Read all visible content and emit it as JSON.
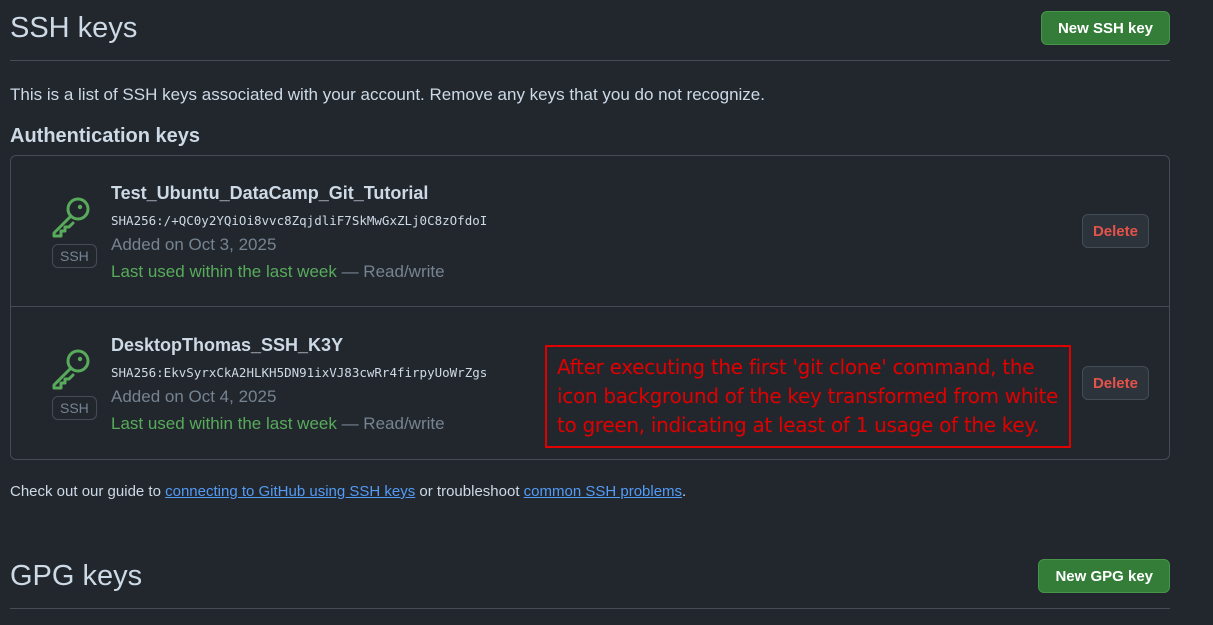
{
  "ssh_section": {
    "title": "SSH keys",
    "new_button": "New SSH key",
    "intro": "This is a list of SSH keys associated with your account. Remove any keys that you do not recognize.",
    "auth_heading": "Authentication keys",
    "keys": [
      {
        "title": "Test_Ubuntu_DataCamp_Git_Tutorial",
        "fingerprint": "SHA256:/+QC0y2YQiOi8vvc8ZqjdliF7SkMwGxZLj0C8zOfdoI",
        "added": "Added on Oct 3, 2025",
        "last_used": "Last used within the last week",
        "access": " — Read/write",
        "badge": "SSH",
        "delete_label": "Delete",
        "icon": "key-icon",
        "icon_color": "#57ab5a"
      },
      {
        "title": "DesktopThomas_SSH_K3Y",
        "fingerprint": "SHA256:EkvSyrxCkA2HLKH5DN91ixVJ83cwRr4firpyUoWrZgs",
        "added": "Added on Oct 4, 2025",
        "last_used": "Last used within the last week",
        "access": " — Read/write",
        "badge": "SSH",
        "delete_label": "Delete",
        "icon": "key-icon",
        "icon_color": "#57ab5a"
      }
    ]
  },
  "annotation": {
    "text": "After executing the first 'git clone' command, the icon background of the key transformed from white to green, indicating at least of 1 usage of the key.",
    "color": "#e00000"
  },
  "guide": {
    "prefix": "Check out our guide to ",
    "link1": "connecting to GitHub using SSH keys",
    "middle": " or troubleshoot ",
    "link2": "common SSH problems",
    "suffix": "."
  },
  "gpg_section": {
    "title": "GPG keys",
    "new_button": "New GPG key"
  },
  "colors": {
    "background": "#22272e",
    "primary_button": "#347d39",
    "link": "#539bf5",
    "danger": "#e5534b",
    "success": "#57ab5a"
  }
}
